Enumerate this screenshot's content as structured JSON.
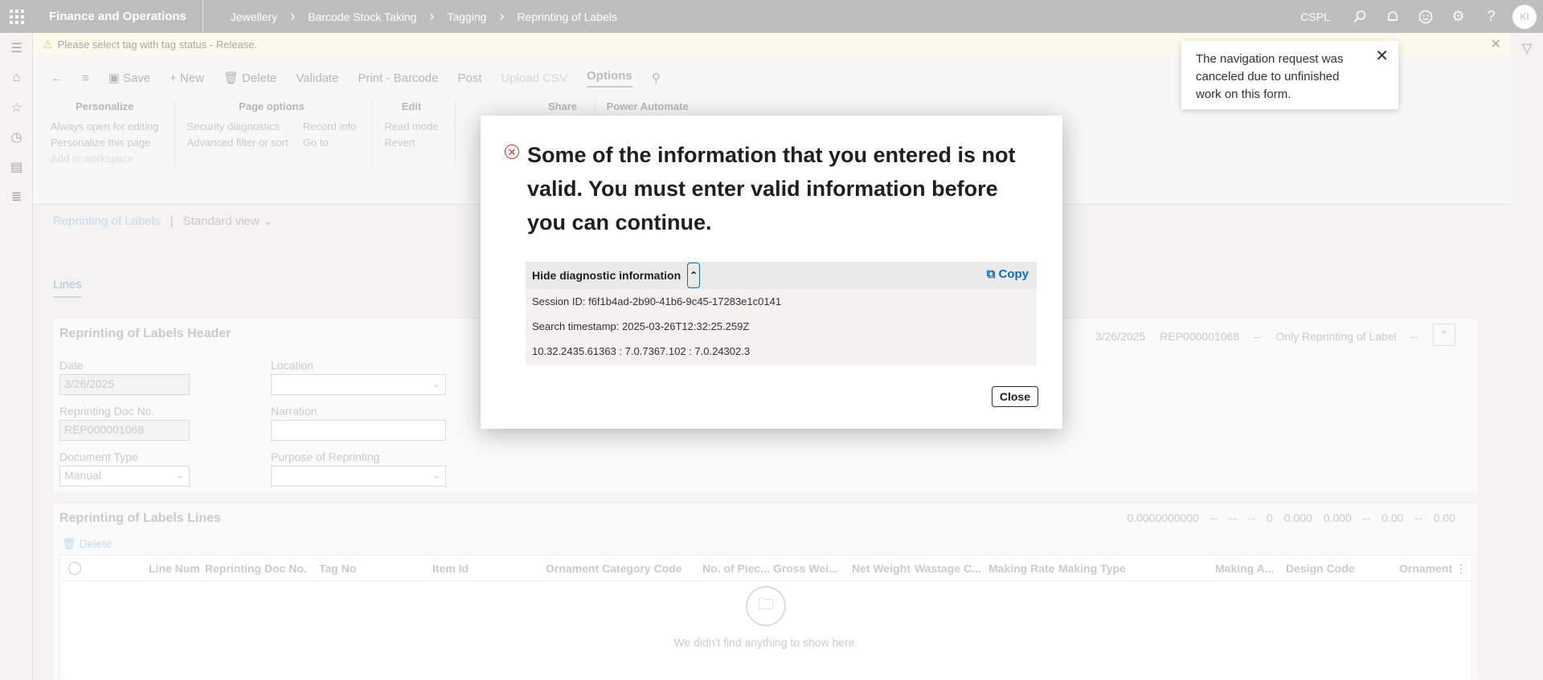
{
  "topbar": {
    "app_title": "Finance and Operations",
    "breadcrumbs": [
      "Jewellery",
      "Barcode Stock Taking",
      "Tagging",
      "Reprinting of Labels"
    ],
    "company": "CSPL",
    "avatar_initials": "KI"
  },
  "warning": {
    "text": "Please select tag with tag status - Release."
  },
  "actionbar": {
    "save": "Save",
    "new": "New",
    "delete": "Delete",
    "validate": "Validate",
    "print_barcode": "Print - Barcode",
    "post": "Post",
    "upload_csv": "Upload CSV",
    "options": "Options"
  },
  "options_groups": {
    "personalize": {
      "title": "Personalize",
      "items": [
        "Always open for editing",
        "Personalize this page",
        "Add to workspace"
      ]
    },
    "page_options": {
      "title": "Page options",
      "col1": [
        "Security diagnostics",
        "Advanced filter or sort"
      ],
      "col2": [
        "Record info",
        "Go to"
      ]
    },
    "edit": {
      "title": "Edit",
      "items": [
        "Read mode",
        "Revert"
      ]
    },
    "share": {
      "title": "Share"
    },
    "power_automate": {
      "title": "Power Automate"
    }
  },
  "page": {
    "title": "Reprinting of Labels",
    "view": "Standard view",
    "tab": "Lines"
  },
  "header_section": {
    "title": "Reprinting of Labels Header",
    "summary": [
      "3/26/2025",
      "REP000001068",
      "--",
      "Only Reprinting of Label",
      "--"
    ],
    "fields": {
      "date_label": "Date",
      "date_value": "3/26/2025",
      "location_label": "Location",
      "location_value": "",
      "doc_no_label": "Reprinting Doc No.",
      "doc_no_value": "REP000001068",
      "narration_label": "Narration",
      "narration_value": "",
      "doc_type_label": "Document Type",
      "doc_type_value": "Manual",
      "purpose_label": "Purpose of Reprinting",
      "purpose_value": ""
    }
  },
  "lines_section": {
    "title": "Reprinting of Labels Lines",
    "summary": [
      "0.0000000000",
      "--",
      "--",
      "--",
      "0",
      "0.000",
      "0.000",
      "--",
      "0.00",
      "--",
      "0.00"
    ],
    "delete": "Delete",
    "columns": [
      "Line Num",
      "Reprinting Doc No.",
      "Tag No",
      "Item Id",
      "Ornament Category Code",
      "No. of Piec...",
      "Gross Wei...",
      "Net Weight",
      "Wastage C...",
      "Making Rate",
      "Making Type",
      "Making A...",
      "Design Code",
      "Ornament"
    ],
    "empty_text": "We didn't find anything to show here."
  },
  "toast": {
    "text": "The navigation request was canceled due to unfinished work on this form."
  },
  "dialog": {
    "message": "Some of the information that you entered is not valid. You must enter valid information before you can continue.",
    "diag_title": "Hide diagnostic information",
    "copy_label": "Copy",
    "session": "Session ID: f6f1b4ad-2b90-41b6-9c45-17283e1c0141",
    "timestamp": "Search timestamp: 2025-03-26T12:32:25.259Z",
    "version": "10.32.2435.61363 : 7.0.7367.102 : 7.0.24302.3",
    "close_label": "Close"
  }
}
